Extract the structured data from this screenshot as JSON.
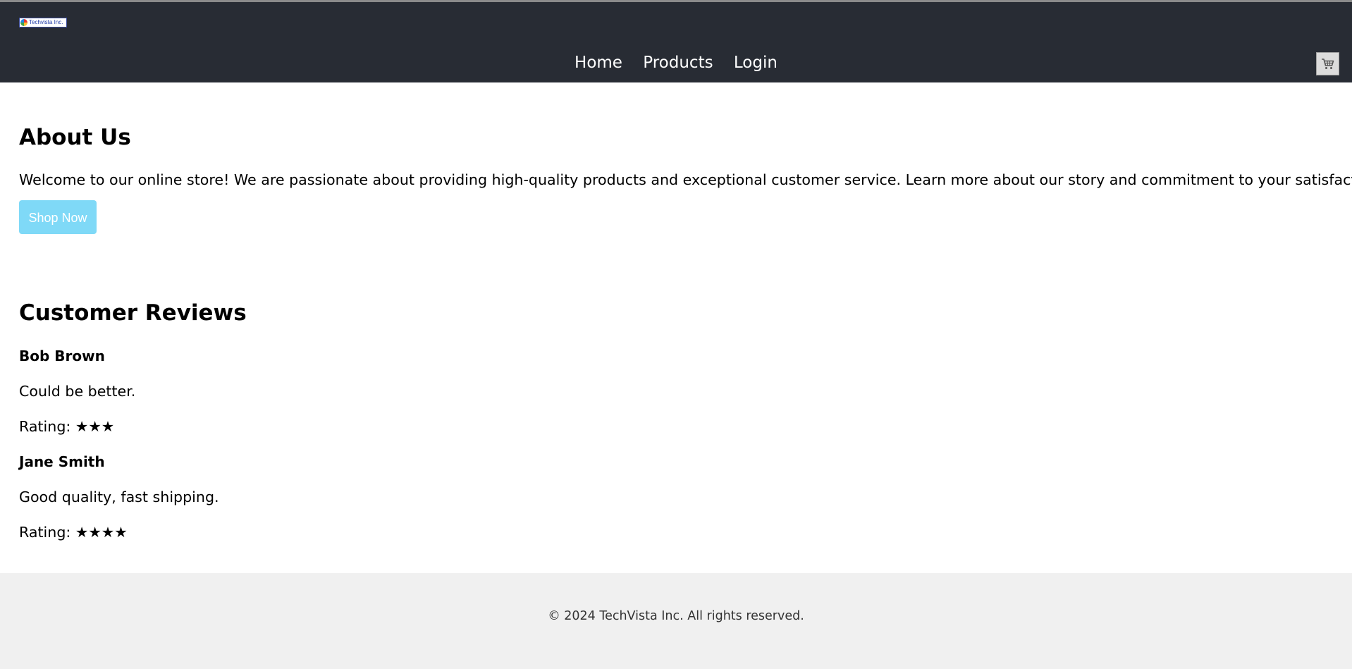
{
  "header": {
    "logo_text": "Techvista Inc.",
    "nav": [
      {
        "label": "Home"
      },
      {
        "label": "Products"
      },
      {
        "label": "Login"
      }
    ],
    "cart_icon": "shopping-cart-icon"
  },
  "about": {
    "title": "About Us",
    "text": "Welcome to our online store! We are passionate about providing high-quality products and exceptional customer service. Learn more about our story and commitment to your satisfaction.",
    "button_label": "Shop Now"
  },
  "reviews": {
    "title": "Customer Reviews",
    "items": [
      {
        "name": "Bob Brown",
        "text": "Could be better.",
        "rating": "Rating: ★★★",
        "stars": 3
      },
      {
        "name": "Jane Smith",
        "text": "Good quality, fast shipping.",
        "rating": "Rating: ★★★★",
        "stars": 4
      }
    ]
  },
  "footer": {
    "text": "© 2024 TechVista Inc. All rights reserved."
  },
  "colors": {
    "header_bg": "#282c34",
    "button_bg": "#7fd9f7",
    "footer_bg": "#f0f0f0"
  }
}
